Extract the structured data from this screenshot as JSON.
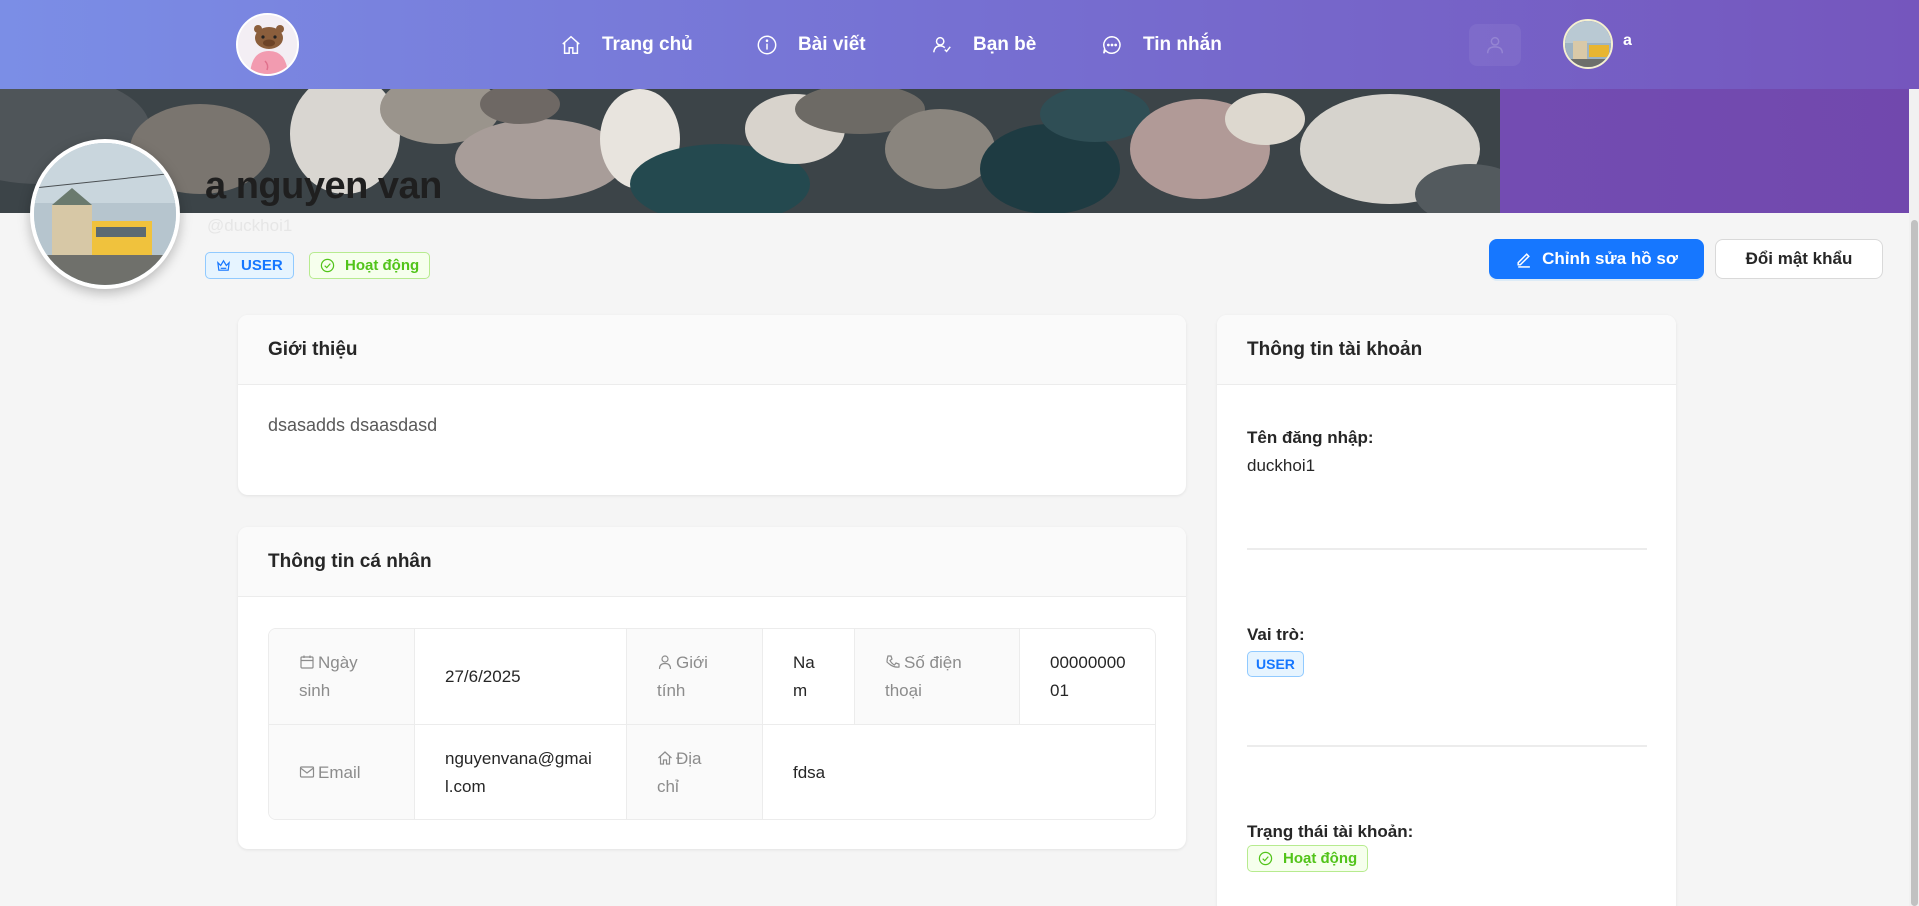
{
  "nav": {
    "home": "Trang chủ",
    "posts": "Bài viết",
    "friends": "Bạn bè",
    "messages": "Tin nhắn",
    "user_name": "a"
  },
  "profile": {
    "full_name": "a nguyen van",
    "handle": "@duckhoi1",
    "role_tag": "USER",
    "status_tag": "Hoạt động",
    "edit_button": "Chỉnh sửa hồ sơ",
    "password_button": "Đổi mật khẩu"
  },
  "about": {
    "title": "Giới thiệu",
    "text": "dsasadds dsaasdasd"
  },
  "personal": {
    "title": "Thông tin cá nhân",
    "birthday_label": "Ngày sinh",
    "birthday_value": "27/6/2025",
    "gender_label": "Giới tính",
    "gender_value": "Nam",
    "phone_label": "Số điện thoại",
    "phone_value": "0000000001",
    "email_label": "Email",
    "email_value": "nguyenvana@gmail.com",
    "address_label": "Địa chỉ",
    "address_value": "fdsa"
  },
  "account": {
    "title": "Thông tin tài khoản",
    "username_label": "Tên đăng nhập:",
    "username_value": "duckhoi1",
    "role_label": "Vai trò:",
    "role_value": "USER",
    "status_label": "Trạng thái tài khoản:",
    "status_value": "Hoạt động"
  },
  "colors": {
    "primary": "#1677ff",
    "header_start": "#7b8ee6",
    "header_end": "#7556bd",
    "success": "#52c41a"
  }
}
